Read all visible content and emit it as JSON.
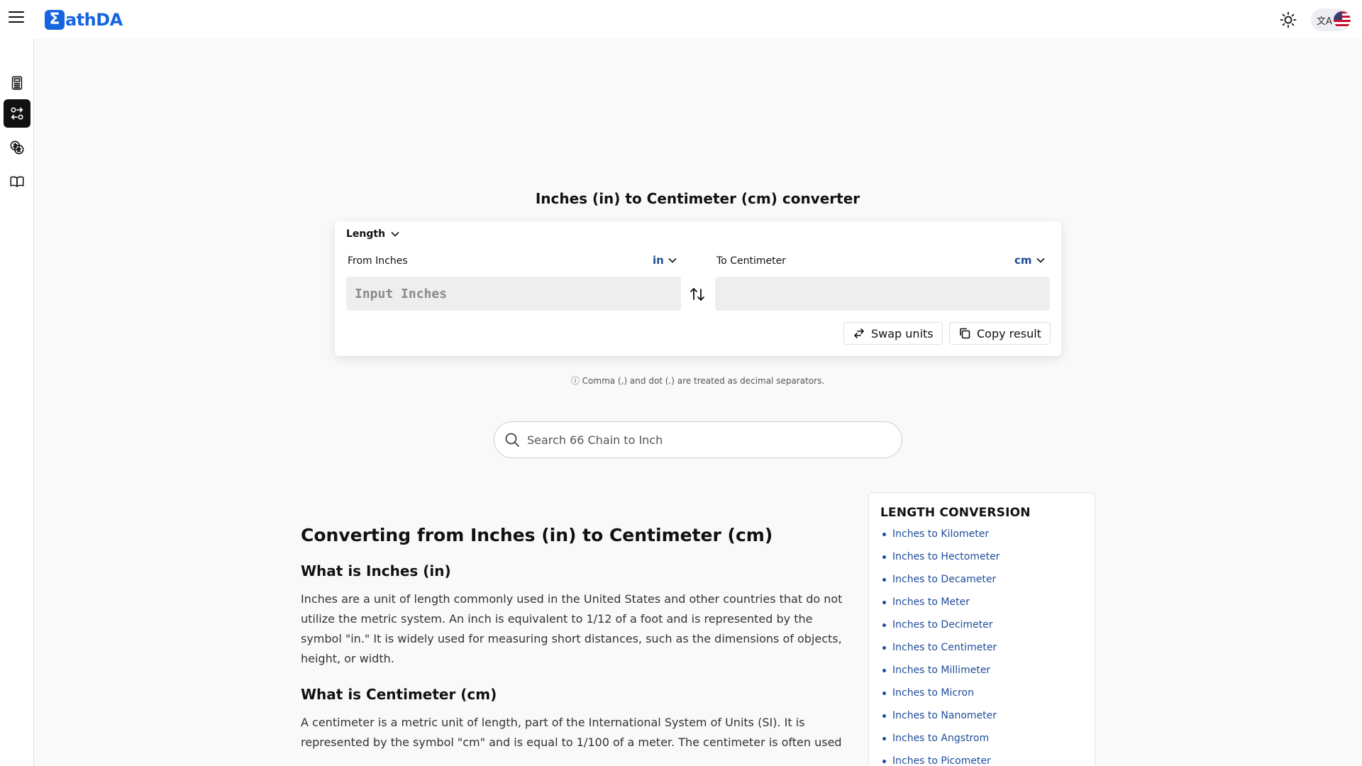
{
  "brand": {
    "logo_mark": "Σ",
    "name": "athDA"
  },
  "header": {
    "lang_icon_text": "文A"
  },
  "sidebar": {
    "items": [
      {
        "name": "calculator-icon"
      },
      {
        "name": "unit-converter-icon",
        "active": true
      },
      {
        "name": "currency-icon"
      },
      {
        "name": "book-icon"
      }
    ]
  },
  "converter": {
    "title": "Inches (in) to Centimeter (cm) converter",
    "category": "Length",
    "from_label": "From Inches",
    "from_unit": "in",
    "to_label": "To Centimeter",
    "to_unit": "cm",
    "input_placeholder": "Input Inches",
    "output_value": "",
    "swap_label": "Swap units",
    "copy_label": "Copy result",
    "note": "ⓘ Comma (,) and dot (.) are treated as decimal separators."
  },
  "search": {
    "placeholder": "Search 66 Chain to Inch"
  },
  "article": {
    "heading": "Converting from Inches (in) to Centimeter (cm)",
    "sections": [
      {
        "title": "What is Inches (in)",
        "text": "Inches are a unit of length commonly used in the United States and other countries that do not utilize the metric system. An inch is equivalent to 1/12 of a foot and is represented by the symbol \"in.\" It is widely used for measuring short distances, such as the dimensions of objects, height, or width."
      },
      {
        "title": "What is Centimeter (cm)",
        "text": "A centimeter is a metric unit of length, part of the International System of Units (SI). It is represented by the symbol \"cm\" and is equal to 1/100 of a meter. The centimeter is often used"
      }
    ]
  },
  "panel": {
    "title": "LENGTH CONVERSION",
    "links": [
      "Inches to Kilometer",
      "Inches to Hectometer",
      "Inches to Decameter",
      "Inches to Meter",
      "Inches to Decimeter",
      "Inches to Centimeter",
      "Inches to Millimeter",
      "Inches to Micron",
      "Inches to Nanometer",
      "Inches to Angstrom",
      "Inches to Picometer"
    ]
  },
  "colors": {
    "brand": "#1565e0",
    "link": "#1e4c9a",
    "background": "#f9f9f9"
  }
}
